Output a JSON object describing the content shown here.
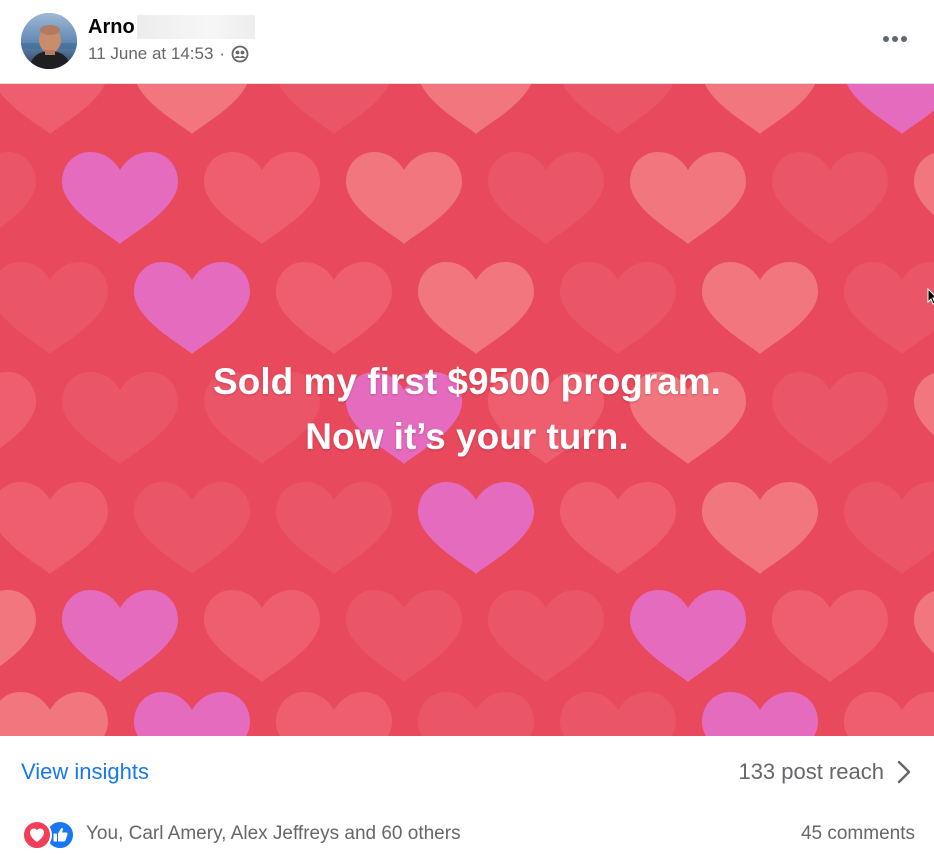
{
  "post": {
    "author": "Arno",
    "timestamp": "11 June at 14:53",
    "meta_separator": "·",
    "audience_icon": "friends-icon",
    "more_icon": "more-options-icon",
    "image": {
      "text_line1": "Sold my first $9500 program.",
      "text_line2": "Now it’s your turn.",
      "background_color": "#e8495d",
      "heart_colors": [
        "#ef6171",
        "#f27b82",
        "#e46fc9",
        "#ea5668"
      ]
    },
    "insights": {
      "view_label": "View insights",
      "reach_label": "133 post reach",
      "chevron_icon": "chevron-right-icon"
    },
    "reactions": {
      "icons": [
        "love-reaction-icon",
        "like-reaction-icon"
      ],
      "summary": "You, Carl Amery, Alex Jeffreys and 60 others",
      "comments": "45 comments"
    },
    "colors": {
      "link": "#1877f2",
      "secondary_text": "#65676b",
      "like_blue": "#1877f2",
      "love_red": "#f33e58"
    }
  }
}
